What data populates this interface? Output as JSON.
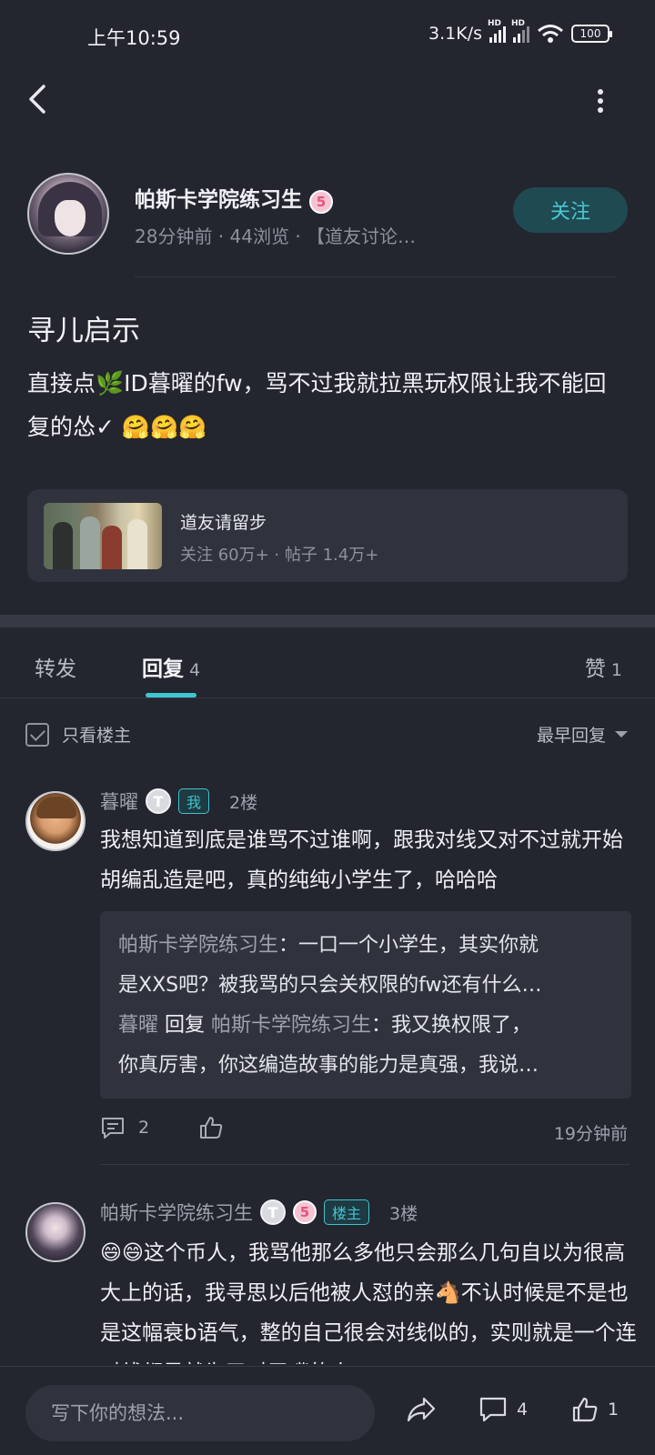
{
  "status_bar": {
    "time": "上午10:59",
    "net_speed": "3.1K/s",
    "signal_label": "HD",
    "battery": "100"
  },
  "author": {
    "name": "帕斯卡学院练习生",
    "level_badge": "5",
    "meta": "28分钟前 · 44浏览 · 【道友讨论…",
    "follow_label": "关注"
  },
  "post": {
    "title": "寻儿启示",
    "body": "直接点🌿ID暮曜的fw，骂不过我就拉黑玩权限让我不能回复的怂✓ 🤗🤗🤗"
  },
  "topic": {
    "name": "道友请留步",
    "stats": "关注 60万+ · 帖子 1.4万+"
  },
  "tabs": {
    "repost": "转发",
    "reply": "回复",
    "reply_count": "4",
    "like": "赞",
    "like_count": "1"
  },
  "filter": {
    "only_host": "只看楼主",
    "sort": "最早回复"
  },
  "comments": [
    {
      "name": "暮曜",
      "t_badge": "T",
      "tag": "我",
      "floor": "2楼",
      "text": " 我想知道到底是谁骂不过谁啊，跟我对线又对不过就开始胡编乱造是吧，真的纯纯小学生了，哈哈哈",
      "quote": {
        "line1_name": "帕斯卡学院练习生",
        "line1_text": "：一口一个小学生，其实你就",
        "line2": "是XXS吧？被我骂的只会关权限的fw还有什么…",
        "line3_name": "暮曜",
        "line3_reply": " 回复 ",
        "line3_target": "帕斯卡学院练习生",
        "line3_text": "：我又换权限了，",
        "line4": "你真厉害，你这编造故事的能力是真强，我说…"
      },
      "reply_count": "2",
      "time": "19分钟前"
    },
    {
      "name": "帕斯卡学院练习生",
      "t_badge": "T",
      "level_badge": "5",
      "tag": "楼主",
      "floor": "3楼",
      "text": "😄😄这个币人，我骂他那么多他只会那么几句自以为很高大上的话，我寻思以后他被人怼的亲🐴不认时候是不是也是这幅衰b语气，整的自己很会对线似的，实则就是一个连对线都是就为了对于嘴的人"
    }
  ],
  "bottom_bar": {
    "placeholder": "写下你的想法...",
    "comment_count": "4",
    "like_count": "1"
  },
  "colors": {
    "accent": "#3ec5cf",
    "background": "#23252f",
    "card": "#30333e"
  }
}
